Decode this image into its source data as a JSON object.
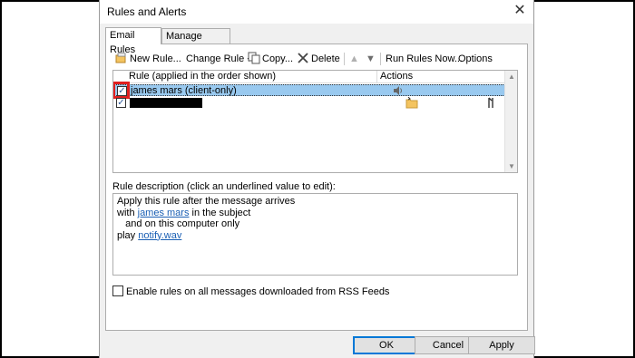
{
  "window": {
    "title": "Rules and Alerts",
    "close_glyph": "✕"
  },
  "tabs": [
    {
      "label": "Email Rules",
      "active": true
    },
    {
      "label": "Manage Alerts",
      "active": false
    }
  ],
  "toolbar": {
    "new_rule": "New Rule...",
    "change_rule": "Change Rule",
    "copy": "Copy...",
    "delete": "Delete",
    "run_rules_now": "Run Rules Now...",
    "options": "Options"
  },
  "rules_table": {
    "columns": [
      "Rule (applied in the order shown)",
      "Actions"
    ],
    "rows": [
      {
        "name": "james mars  (client-only)",
        "checked": true,
        "selected": true,
        "actions": [
          "sound-icon"
        ]
      },
      {
        "name": "",
        "checked": true,
        "selected": false,
        "redacted": true,
        "actions": [
          "folder-move-icon",
          "exception-icon"
        ]
      }
    ]
  },
  "description": {
    "label": "Rule description (click an underlined value to edit):",
    "line1": "Apply this rule after the message arrives",
    "line2_prefix": "with ",
    "line2_link": "james mars",
    "line2_suffix": " in the subject",
    "line3": "   and on this computer only",
    "line4_prefix": "play ",
    "line4_link": "notify.wav"
  },
  "rss_option": {
    "label": "Enable rules on all messages downloaded from RSS Feeds",
    "checked": false
  },
  "buttons": {
    "ok": "OK",
    "cancel": "Cancel",
    "apply": "Apply"
  },
  "colors": {
    "accent": "#0078d7",
    "selection": "#99c9ef",
    "highlight_box": "#e02020",
    "link": "#1a5fb4"
  }
}
